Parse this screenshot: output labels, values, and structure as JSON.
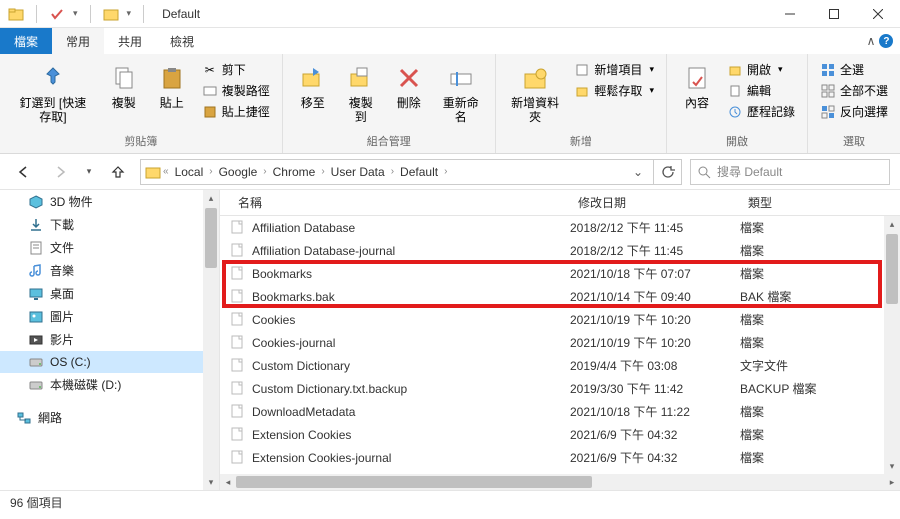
{
  "window": {
    "title": "Default"
  },
  "tabs": {
    "file": "檔案",
    "home": "常用",
    "share": "共用",
    "view": "檢視"
  },
  "ribbon": {
    "clipboard": {
      "pin": "釘選到 [快速存取]",
      "copy": "複製",
      "paste": "貼上",
      "cut": "剪下",
      "copy_path": "複製路徑",
      "paste_shortcut": "貼上捷徑",
      "label": "剪貼簿"
    },
    "organize": {
      "move_to": "移至",
      "copy_to": "複製到",
      "delete": "刪除",
      "rename": "重新命名",
      "label": "組合管理"
    },
    "new": {
      "new_folder": "新增資料夾",
      "new_item": "新增項目",
      "easy_access": "輕鬆存取",
      "label": "新增"
    },
    "open": {
      "properties": "內容",
      "open": "開啟",
      "edit": "編輯",
      "history": "歷程記錄",
      "label": "開啟"
    },
    "select": {
      "select_all": "全選",
      "select_none": "全部不選",
      "invert": "反向選擇",
      "label": "選取"
    }
  },
  "breadcrumb": [
    "Local",
    "Google",
    "Chrome",
    "User Data",
    "Default"
  ],
  "search": {
    "placeholder": "搜尋 Default"
  },
  "nav_items": [
    {
      "icon": "cube",
      "label": "3D 物件"
    },
    {
      "icon": "download",
      "label": "下載"
    },
    {
      "icon": "doc",
      "label": "文件"
    },
    {
      "icon": "music",
      "label": "音樂"
    },
    {
      "icon": "desktop",
      "label": "桌面"
    },
    {
      "icon": "picture",
      "label": "圖片"
    },
    {
      "icon": "video",
      "label": "影片"
    },
    {
      "icon": "disk",
      "label": "OS (C:)",
      "selected": true
    },
    {
      "icon": "disk",
      "label": "本機磁碟 (D:)"
    },
    {
      "icon": "network",
      "label": "網路",
      "indent": true
    }
  ],
  "columns": {
    "name": "名稱",
    "date": "修改日期",
    "type": "類型"
  },
  "files": [
    {
      "name": "Affiliation Database",
      "date": "2018/2/12 下午 11:45",
      "type": "檔案"
    },
    {
      "name": "Affiliation Database-journal",
      "date": "2018/2/12 下午 11:45",
      "type": "檔案"
    },
    {
      "name": "Bookmarks",
      "date": "2021/10/18 下午 07:07",
      "type": "檔案",
      "hl": true
    },
    {
      "name": "Bookmarks.bak",
      "date": "2021/10/14 下午 09:40",
      "type": "BAK 檔案",
      "hl": true
    },
    {
      "name": "Cookies",
      "date": "2021/10/19 下午 10:20",
      "type": "檔案"
    },
    {
      "name": "Cookies-journal",
      "date": "2021/10/19 下午 10:20",
      "type": "檔案"
    },
    {
      "name": "Custom Dictionary",
      "date": "2019/4/4 下午 03:08",
      "type": "文字文件"
    },
    {
      "name": "Custom Dictionary.txt.backup",
      "date": "2019/3/30 下午 11:42",
      "type": "BACKUP 檔案"
    },
    {
      "name": "DownloadMetadata",
      "date": "2021/10/18 下午 11:22",
      "type": "檔案"
    },
    {
      "name": "Extension Cookies",
      "date": "2021/6/9 下午 04:32",
      "type": "檔案"
    },
    {
      "name": "Extension Cookies-journal",
      "date": "2021/6/9 下午 04:32",
      "type": "檔案"
    }
  ],
  "status": {
    "count": "96 個項目"
  }
}
